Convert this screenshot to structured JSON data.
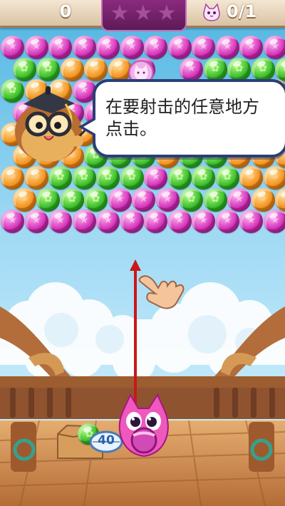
{
  "hud": {
    "score": "0",
    "stars_total": 3,
    "goal_count": "0/1",
    "colors": {
      "gold": "#f6d18a",
      "plum": "#7a2570"
    }
  },
  "bubbles": {
    "rows": [
      [
        "pink",
        "pink",
        "pink",
        "pink",
        "pink",
        "pink",
        "pink",
        "pink",
        "pink",
        "pink",
        "pink",
        "pink"
      ],
      [
        "green",
        "green",
        "orange",
        "orange",
        "orange",
        "pink",
        "cat",
        "pink",
        "green",
        "green",
        "green",
        "green"
      ],
      [
        "green",
        "orange",
        "orange",
        "pink",
        "pink",
        "pink",
        "green",
        "green",
        "green",
        "pink",
        "orange",
        "orange"
      ],
      [
        "pink",
        "pink",
        "pink",
        "pink",
        "green",
        "pink",
        "pink",
        "pink",
        "pink",
        "pink",
        "pink",
        "pink"
      ],
      [
        "orange",
        "orange",
        "orange",
        "orange",
        "green",
        "green",
        "pink",
        "pink",
        "green",
        "green",
        "orange",
        "orange"
      ],
      [
        "orange",
        "orange",
        "orange",
        "green",
        "green",
        "green",
        "orange",
        "green",
        "green",
        "orange",
        "orange",
        "orange"
      ],
      [
        "orange",
        "orange",
        "green",
        "green",
        "green",
        "green",
        "pink",
        "green",
        "green",
        "green",
        "orange",
        "orange"
      ],
      [
        "orange",
        "green",
        "green",
        "green",
        "pink",
        "pink",
        "pink",
        "green",
        "green",
        "pink",
        "orange",
        "orange"
      ],
      [
        "pink",
        "pink",
        "pink",
        "pink",
        "pink",
        "pink",
        "pink",
        "pink",
        "pink",
        "pink",
        "pink",
        "pink"
      ]
    ],
    "motif_icons": {
      "pink": "★",
      "green": "✿",
      "orange": "✹"
    },
    "colors": {
      "pink": "#d12bb6",
      "green": "#32b924",
      "orange": "#f38d18"
    }
  },
  "tutorial": {
    "message": "在要射击的任意地方点击。"
  },
  "shooter": {
    "remaining_shots": "40",
    "next_bubble": "green",
    "aim_color": "#c91818"
  }
}
